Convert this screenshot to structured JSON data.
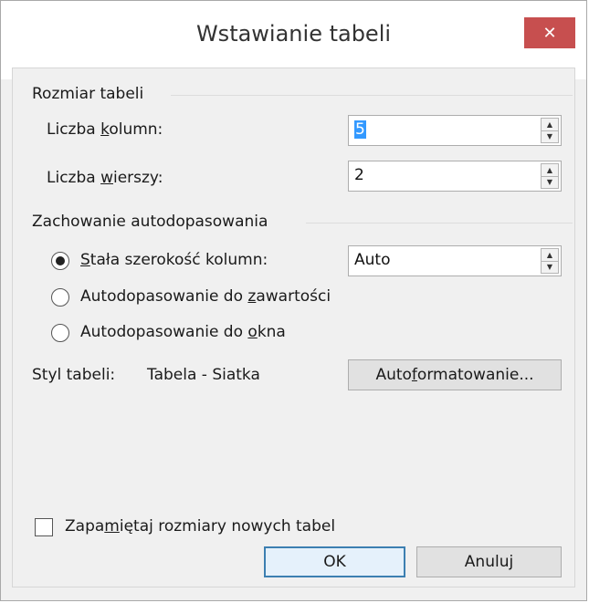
{
  "window": {
    "title": "Wstawianie tabeli"
  },
  "size_group": {
    "title": "Rozmiar tabeli",
    "columns_label_pre": "Liczba ",
    "columns_label_u": "k",
    "columns_label_post": "olumn:",
    "columns_value": "5",
    "rows_label_pre": "Liczba ",
    "rows_label_u": "w",
    "rows_label_post": "ierszy:",
    "rows_value": "2"
  },
  "autofit_group": {
    "title": "Zachowanie autodopasowania",
    "fixed_pre": "",
    "fixed_u": "S",
    "fixed_post": "tała szerokość kolumn:",
    "fixed_value": "Auto",
    "contents_pre": "Autodopasowanie do ",
    "contents_u": "z",
    "contents_post": "awartości",
    "window_pre": "Autodopasowanie do ",
    "window_u": "o",
    "window_post": "kna",
    "selected": "fixed"
  },
  "style": {
    "label": "Styl tabeli:",
    "value": "Tabela - Siatka",
    "autoformat_pre": "Auto",
    "autoformat_u": "f",
    "autoformat_post": "ormatowanie..."
  },
  "remember": {
    "pre": "Zapa",
    "u": "m",
    "post": "iętaj rozmiary nowych tabel",
    "checked": false
  },
  "buttons": {
    "ok": "OK",
    "cancel": "Anuluj"
  },
  "colors": {
    "close_bg": "#c74f4f",
    "selection": "#3399ff"
  }
}
